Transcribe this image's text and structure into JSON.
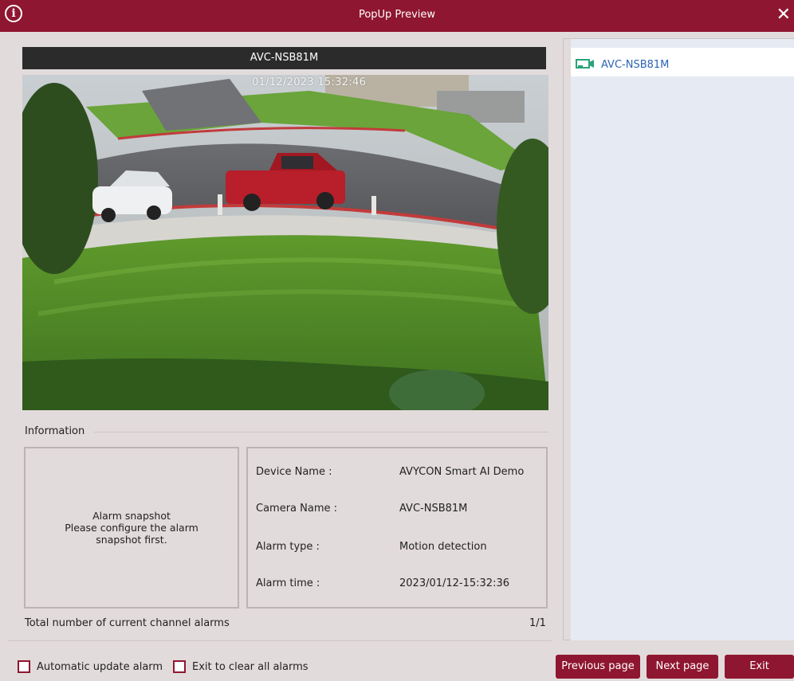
{
  "window": {
    "title": "PopUp Preview",
    "info_icon": "info-icon",
    "close_icon": "close-icon",
    "accent_color": "#8f1630"
  },
  "preview": {
    "camera_name": "AVC-NSB81M",
    "osd_timestamp": "01/12/2023 15:32:46"
  },
  "information": {
    "section_label": "Information",
    "snapshot_lines": [
      "Alarm snapshot",
      "Please configure the alarm",
      "snapshot first."
    ],
    "details": [
      {
        "label": "Device Name :",
        "value": "AVYCON Smart AI Demo"
      },
      {
        "label": "Camera Name :",
        "value": "AVC-NSB81M"
      },
      {
        "label": "Alarm type :",
        "value": "Motion detection"
      },
      {
        "label": "Alarm time :",
        "value": "2023/01/12-15:32:36"
      }
    ],
    "total_label": "Total number of current channel alarms",
    "total_count": "1/1"
  },
  "channel_list": {
    "items": [
      {
        "label": "AVC-NSB81M",
        "icon": "camera-icon"
      }
    ]
  },
  "footer": {
    "auto_update_label": "Automatic update alarm",
    "exit_clear_label": "Exit to clear all alarms",
    "prev_label": "Previous page",
    "next_label": "Next page",
    "exit_label": "Exit"
  }
}
